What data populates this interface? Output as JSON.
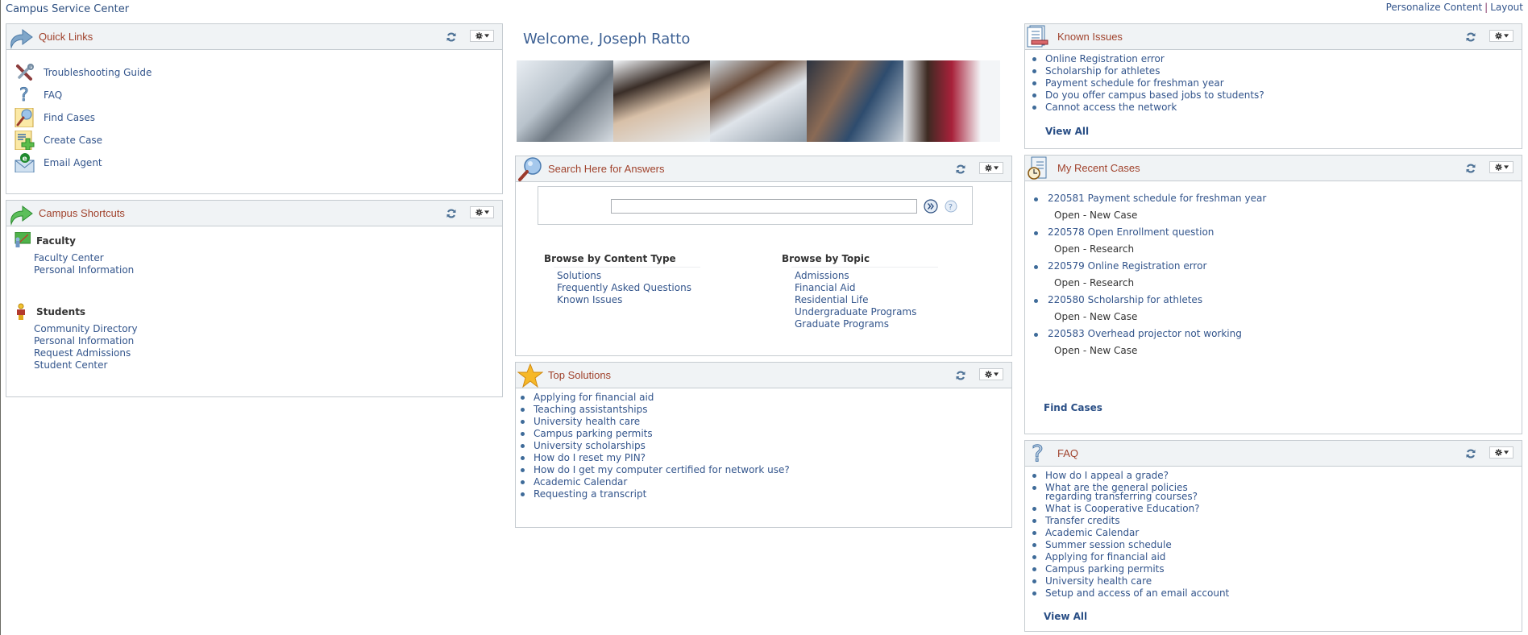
{
  "header": {
    "site_title": "Campus Service Center",
    "personalize_content": "Personalize Content",
    "separator": "|",
    "layout": "Layout"
  },
  "colors": {
    "pagelet_title": "#a0422c",
    "link": "#33558c",
    "header_bg": "#f0f3f5",
    "border": "#c5cbd0"
  },
  "quick_links": {
    "title": "Quick Links",
    "items": [
      {
        "label": "Troubleshooting Guide",
        "icon": "tools-icon"
      },
      {
        "label": "FAQ",
        "icon": "question-icon"
      },
      {
        "label": "Find Cases",
        "icon": "magnifier-icon"
      },
      {
        "label": "Create Case",
        "icon": "add-document-icon"
      },
      {
        "label": "Email Agent",
        "icon": "email-icon"
      }
    ]
  },
  "campus_shortcuts": {
    "title": "Campus Shortcuts",
    "groups": [
      {
        "heading": "Faculty",
        "links": [
          "Faculty Center",
          "Personal Information"
        ]
      },
      {
        "heading": "Students",
        "links": [
          "Community Directory",
          "Personal Information",
          "Request Admissions",
          "Student Center"
        ]
      }
    ]
  },
  "welcome": {
    "text": "Welcome, Joseph Ratto"
  },
  "search": {
    "title": "Search Here for Answers",
    "input_value": "",
    "browse_content_type": {
      "heading": "Browse by Content Type",
      "links": [
        "Solutions",
        "Frequently Asked Questions",
        "Known Issues"
      ]
    },
    "browse_topic": {
      "heading": "Browse by Topic",
      "links": [
        "Admissions",
        "Financial Aid",
        "Residential Life",
        "Undergraduate Programs",
        "Graduate Programs"
      ]
    }
  },
  "top_solutions": {
    "title": "Top Solutions",
    "items": [
      "Applying for financial aid",
      "Teaching assistantships",
      "University health care",
      "Campus parking permits",
      "University scholarships",
      "How do I reset my PIN?",
      "How do I get my computer certified for network use?",
      "Academic Calendar",
      "Requesting a transcript"
    ]
  },
  "known_issues": {
    "title": "Known Issues",
    "items": [
      "Online Registration error",
      "Scholarship for athletes",
      "Payment schedule for freshman year",
      "Do you offer campus based jobs to students?",
      "Cannot access the network"
    ],
    "view_all": "View All"
  },
  "recent_cases": {
    "title": "My Recent Cases",
    "cases": [
      {
        "title": "220581 Payment schedule for freshman year",
        "status": "Open - New Case"
      },
      {
        "title": "220578 Open Enrollment question",
        "status": "Open - Research"
      },
      {
        "title": "220579 Online Registration error",
        "status": "Open - Research"
      },
      {
        "title": "220580 Scholarship for athletes",
        "status": "Open - New Case"
      },
      {
        "title": "220583 Overhead projector not working",
        "status": "Open - New Case"
      }
    ],
    "find_cases": "Find Cases"
  },
  "faq": {
    "title": "FAQ",
    "items": [
      "How do I appeal a grade?",
      "What are the general policies regarding transferring courses?",
      "What is Cooperative Education?",
      "Transfer credits",
      "Academic Calendar",
      "Summer session schedule",
      "Applying for financial aid",
      "Campus parking permits",
      "University health care",
      "Setup and access of an email account"
    ],
    "view_all": "View All"
  }
}
